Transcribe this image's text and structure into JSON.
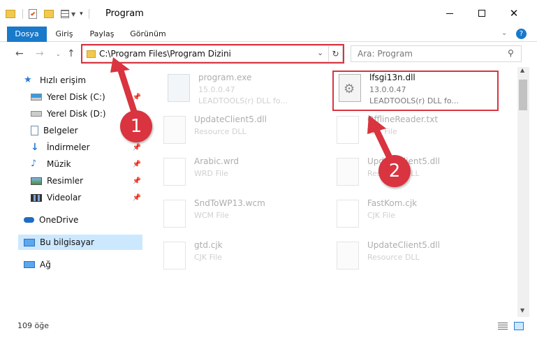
{
  "window": {
    "title": "Program",
    "min_icon": "minimize-icon",
    "max_icon": "maximize-icon",
    "close_icon": "close-icon"
  },
  "ribbon": {
    "tabs": [
      {
        "label": "Dosya"
      },
      {
        "label": "Giriş"
      },
      {
        "label": "Paylaş"
      },
      {
        "label": "Görünüm"
      }
    ]
  },
  "address": {
    "path": "C:\\Program Files\\Program Dizini"
  },
  "search": {
    "placeholder": "Ara: Program"
  },
  "sidebar": {
    "items": [
      {
        "label": "Hızlı erişim"
      },
      {
        "label": "Yerel Disk (C:)"
      },
      {
        "label": "Yerel Disk (D:)"
      },
      {
        "label": "Belgeler"
      },
      {
        "label": "İndirmeler"
      },
      {
        "label": "Müzik"
      },
      {
        "label": "Resimler"
      },
      {
        "label": "Videolar"
      },
      {
        "label": "OneDrive"
      },
      {
        "label": "Bu bilgisayar"
      },
      {
        "label": "Ağ"
      }
    ]
  },
  "files": [
    {
      "name": "program.exe",
      "line2": "15.0.0.47",
      "line3": "LEADTOOLS(r) DLL fo..."
    },
    {
      "name": "lfsgi13n.dll",
      "line2": "13.0.0.47",
      "line3": "LEADTOOLS(r) DLL fo..."
    },
    {
      "name": "UpdateClient5.dll",
      "line2": "Resource DLL",
      "line3": ""
    },
    {
      "name": "OfflineReader.txt",
      "line2": "TXT File",
      "line3": ""
    },
    {
      "name": "Arabic.wrd",
      "line2": "WRD File",
      "line3": ""
    },
    {
      "name": "UpdateClient5.dll",
      "line2": "Resource DLL",
      "line3": ""
    },
    {
      "name": "SndToWP13.wcm",
      "line2": "WCM File",
      "line3": ""
    },
    {
      "name": "FastKom.cjk",
      "line2": "CJK File",
      "line3": ""
    },
    {
      "name": "gtd.cjk",
      "line2": "CJK File",
      "line3": ""
    },
    {
      "name": "UpdateClient5.dll",
      "line2": "Resource DLL",
      "line3": ""
    }
  ],
  "status": {
    "count": "109 öğe"
  },
  "annotations": {
    "badge1": "1",
    "badge2": "2",
    "color": "#d9343f"
  }
}
